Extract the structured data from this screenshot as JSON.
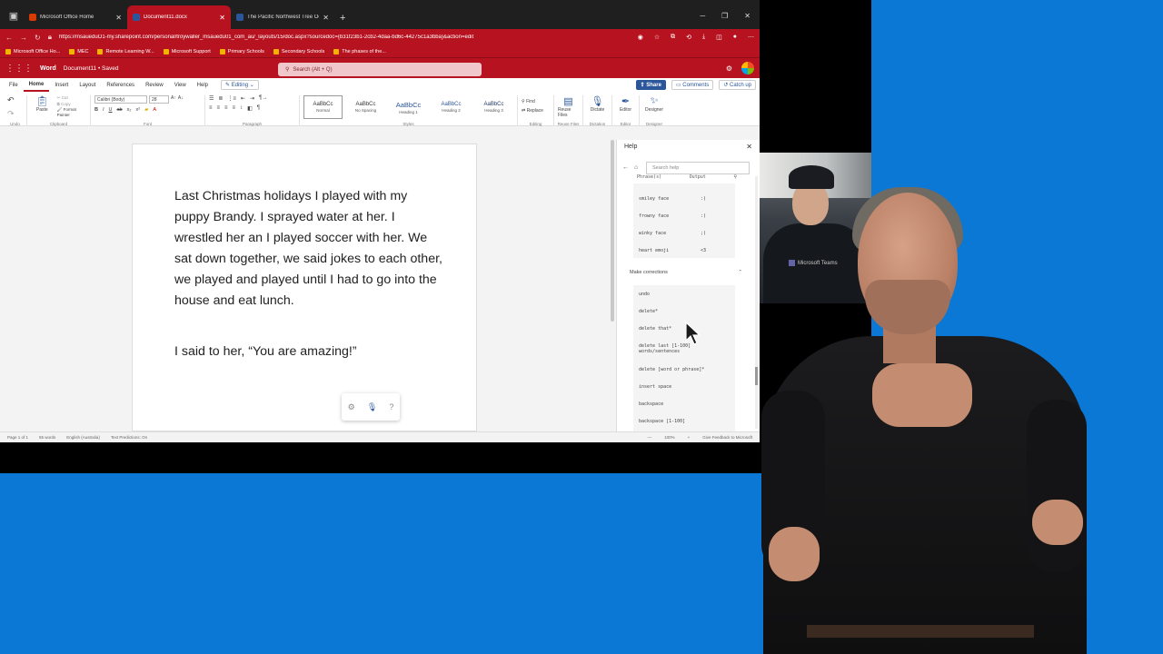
{
  "browser": {
    "tabs": [
      {
        "label": "Microsoft Office Home",
        "color": "#d83b01"
      },
      {
        "label": "Document11.docx",
        "color": "#2b579a"
      },
      {
        "label": "The Pacific Northwest Tree Octo...",
        "color": "#2b579a"
      }
    ],
    "url": "https://msaueduO1-my.sharepoint.com/personal/troywaller_msauedu01_com_au/_layouts/15/doc.aspx?sourcedoc={b31f23b1-2cb2-4daa-bd6c-44275c1a3bba}&action=edit",
    "bookmarks": [
      "Microsoft Office Ho...",
      "MEC",
      "Remote Learning W...",
      "Microsoft Support",
      "Primary Schools",
      "Secondary Schools",
      "The phases of the..."
    ]
  },
  "word": {
    "app_name": "Word",
    "doc_name": "Document11 • Saved",
    "search_placeholder": "Search (Alt + Q)",
    "ribbon_tabs": [
      "File",
      "Home",
      "Insert",
      "Layout",
      "References",
      "Review",
      "View",
      "Help"
    ],
    "editing_label": "Editing",
    "share_label": "Share",
    "comments_label": "Comments",
    "catchup_label": "Catch up",
    "font_name": "Calibri (Body)",
    "font_size": "28",
    "styles": [
      {
        "preview": "AaBbCc",
        "name": "Normal"
      },
      {
        "preview": "AaBbCc",
        "name": "No Spacing"
      },
      {
        "preview": "AaBbCc",
        "name": "Heading 1"
      },
      {
        "preview": "AaBbCc",
        "name": "Heading 2"
      },
      {
        "preview": "AaBbCc",
        "name": "Heading 3"
      }
    ],
    "group_labels": [
      "Undo",
      "Clipboard",
      "Font",
      "Paragraph",
      "Styles",
      "Editing",
      "Reuse Files",
      "Dictation",
      "Editor",
      "Designer"
    ],
    "clipboard": {
      "paste": "Paste",
      "cut": "Cut",
      "copy": "Copy",
      "format_painter": "Format Painter"
    },
    "editing": {
      "find": "Find",
      "replace": "Replace"
    },
    "tools": [
      {
        "label": "Reuse Files",
        "icon": "reuse-files-icon"
      },
      {
        "label": "Dictate",
        "icon": "microphone-icon"
      },
      {
        "label": "Editor",
        "icon": "editor-pen-icon"
      },
      {
        "label": "Designer",
        "icon": "designer-icon"
      }
    ]
  },
  "document": {
    "paragraph1": "Last Christmas holidays I played with my puppy Brandy. I sprayed water at her. I wrestled her an I played soccer with her. We sat down together, we said jokes to each other, we played and played until I had to go into the house and eat lunch.",
    "paragraph2": "I said to her, “You are amazing!”"
  },
  "help": {
    "title": "Help",
    "search_placeholder": "Search help",
    "phrase_header": "Phrase(s)",
    "output_header": "Output",
    "phrases": [
      {
        "phrase": "smiley face",
        "output": ":)"
      },
      {
        "phrase": "frowny face",
        "output": ":("
      },
      {
        "phrase": "winky face",
        "output": ";)"
      },
      {
        "phrase": "heart emoji",
        "output": "<3"
      }
    ],
    "section_title": "Make corrections",
    "commands": [
      "undo",
      "delete*",
      "delete that*",
      "delete last [1-100] words/sentences",
      "delete [word or phrase]*",
      "insert space",
      "backspace",
      "backspace [1-100]"
    ]
  },
  "status": {
    "page": "Page 1 of 1",
    "words": "55 words",
    "language": "English (Australia)",
    "predictions": "Text Predictions: On",
    "zoom": "100%",
    "feedback": "Give Feedback to Microsoft"
  },
  "webcam": {
    "logo_text": "Microsoft Teams"
  }
}
